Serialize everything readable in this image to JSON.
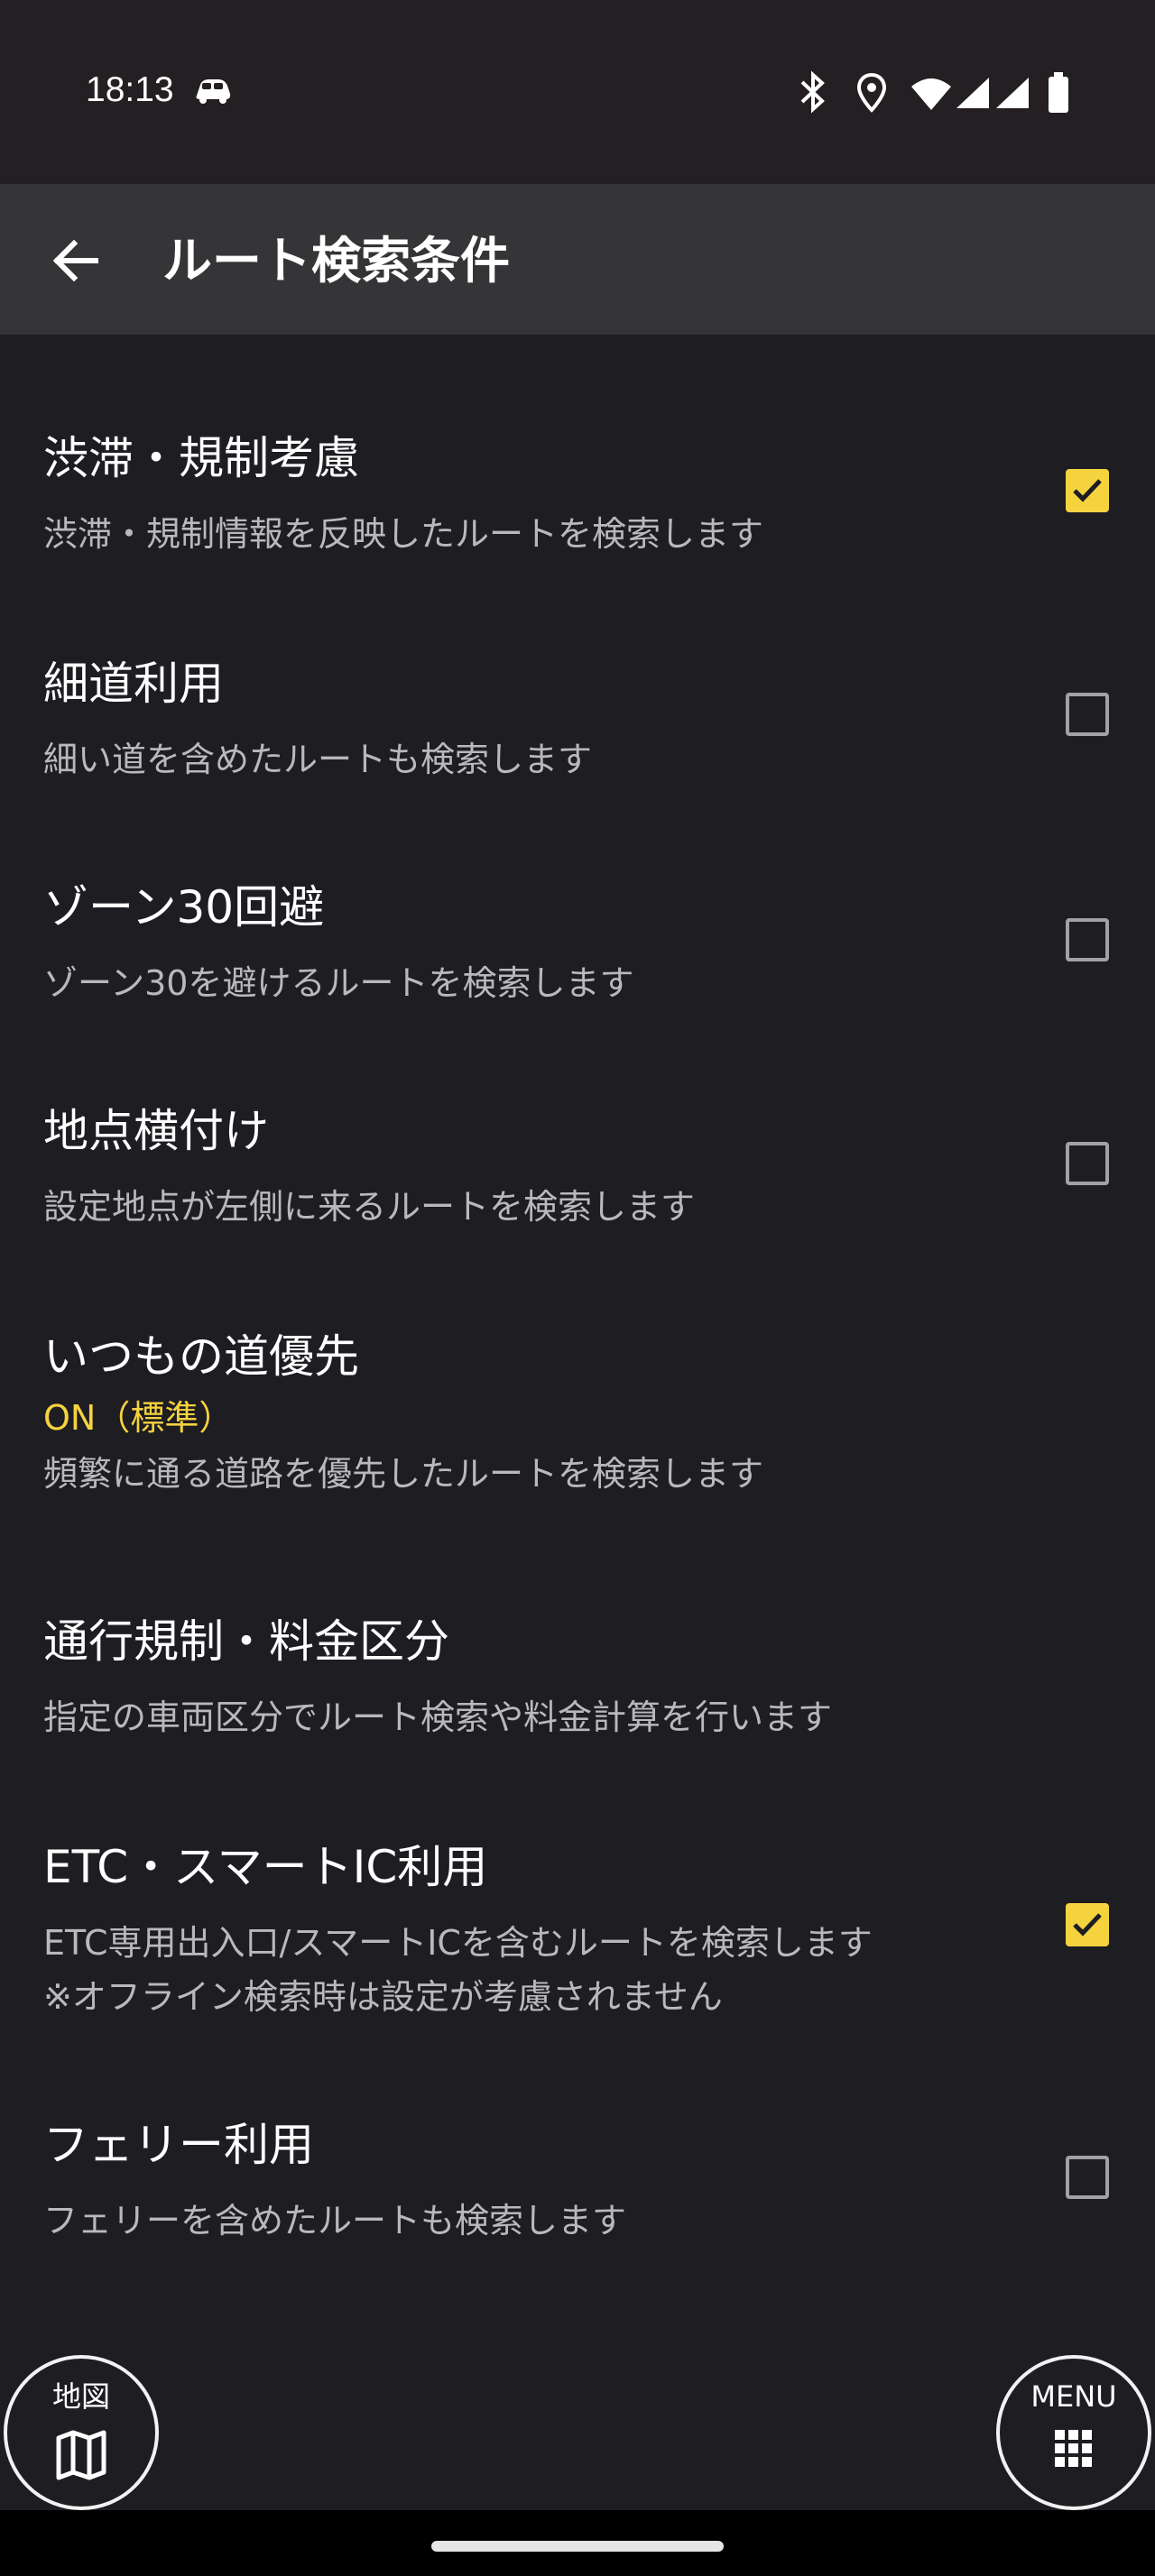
{
  "status_bar": {
    "time": "18:13",
    "icons": [
      "car-icon",
      "bluetooth-icon",
      "location-icon",
      "wifi-icon",
      "signal-icon",
      "signal-icon",
      "battery-icon"
    ]
  },
  "app_bar": {
    "title": "ルート検索条件",
    "back_icon": "arrow-left-icon"
  },
  "settings": [
    {
      "title": "渋滞・規制考慮",
      "description": "渋滞・規制情報を反映したルートを検索します",
      "checked": true
    },
    {
      "title": "細道利用",
      "description": "細い道を含めたルートも検索します",
      "checked": false
    },
    {
      "title": "ゾーン30回避",
      "description": "ゾーン30を避けるルートを検索します",
      "checked": false
    },
    {
      "title": "地点横付け",
      "description": "設定地点が左側に来るルートを検索します",
      "checked": false
    },
    {
      "title": "いつもの道優先",
      "status": "ON（標準）",
      "description": "頻繁に通る道路を優先したルートを検索します"
    },
    {
      "title": "通行規制・料金区分",
      "description": "指定の車両区分でルート検索や料金計算を行います"
    },
    {
      "title": "ETC・スマートIC利用",
      "description": "ETC専用出入口/スマートICを含むルートを検索します",
      "note": "※オフライン検索時は設定が考慮されません",
      "checked": true
    },
    {
      "title": "フェリー利用",
      "description": "フェリーを含めたルートも検索します",
      "checked": false
    }
  ],
  "bottom_buttons": {
    "map_label": "地図",
    "menu_label": "MENU"
  },
  "colors": {
    "background": "#1e1d22",
    "app_bar": "#353538",
    "status_bar": "#231f22",
    "accent": "#f5d33f",
    "secondary_text": "#b9b9bd"
  }
}
